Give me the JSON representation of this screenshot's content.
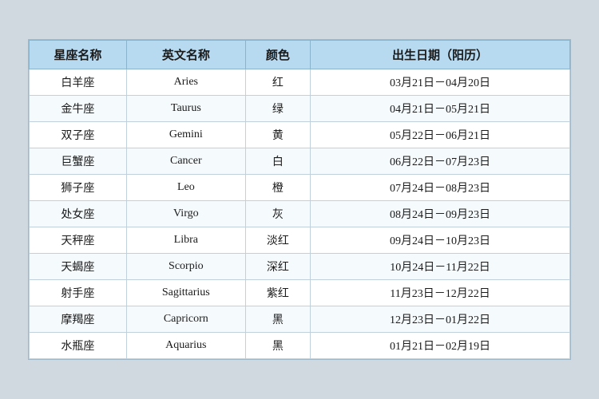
{
  "table": {
    "headers": [
      "星座名称",
      "英文名称",
      "颜色",
      "出生日期（阳历）"
    ],
    "rows": [
      {
        "chinese": "白羊座",
        "english": "Aries",
        "color": "红",
        "date": "03月21日－04月20日"
      },
      {
        "chinese": "金牛座",
        "english": "Taurus",
        "color": "绿",
        "date": "04月21日－05月21日"
      },
      {
        "chinese": "双子座",
        "english": "Gemini",
        "color": "黄",
        "date": "05月22日－06月21日"
      },
      {
        "chinese": "巨蟹座",
        "english": "Cancer",
        "color": "白",
        "date": "06月22日－07月23日"
      },
      {
        "chinese": "狮子座",
        "english": "Leo",
        "color": "橙",
        "date": "07月24日－08月23日"
      },
      {
        "chinese": "处女座",
        "english": "Virgo",
        "color": "灰",
        "date": "08月24日－09月23日"
      },
      {
        "chinese": "天秤座",
        "english": "Libra",
        "color": "淡红",
        "date": "09月24日－10月23日"
      },
      {
        "chinese": "天蝎座",
        "english": "Scorpio",
        "color": "深红",
        "date": "10月24日－11月22日"
      },
      {
        "chinese": "射手座",
        "english": "Sagittarius",
        "color": "紫红",
        "date": "11月23日－12月22日"
      },
      {
        "chinese": "摩羯座",
        "english": "Capricorn",
        "color": "黑",
        "date": "12月23日－01月22日"
      },
      {
        "chinese": "水瓶座",
        "english": "Aquarius",
        "color": "黑",
        "date": "01月21日－02月19日"
      }
    ]
  }
}
